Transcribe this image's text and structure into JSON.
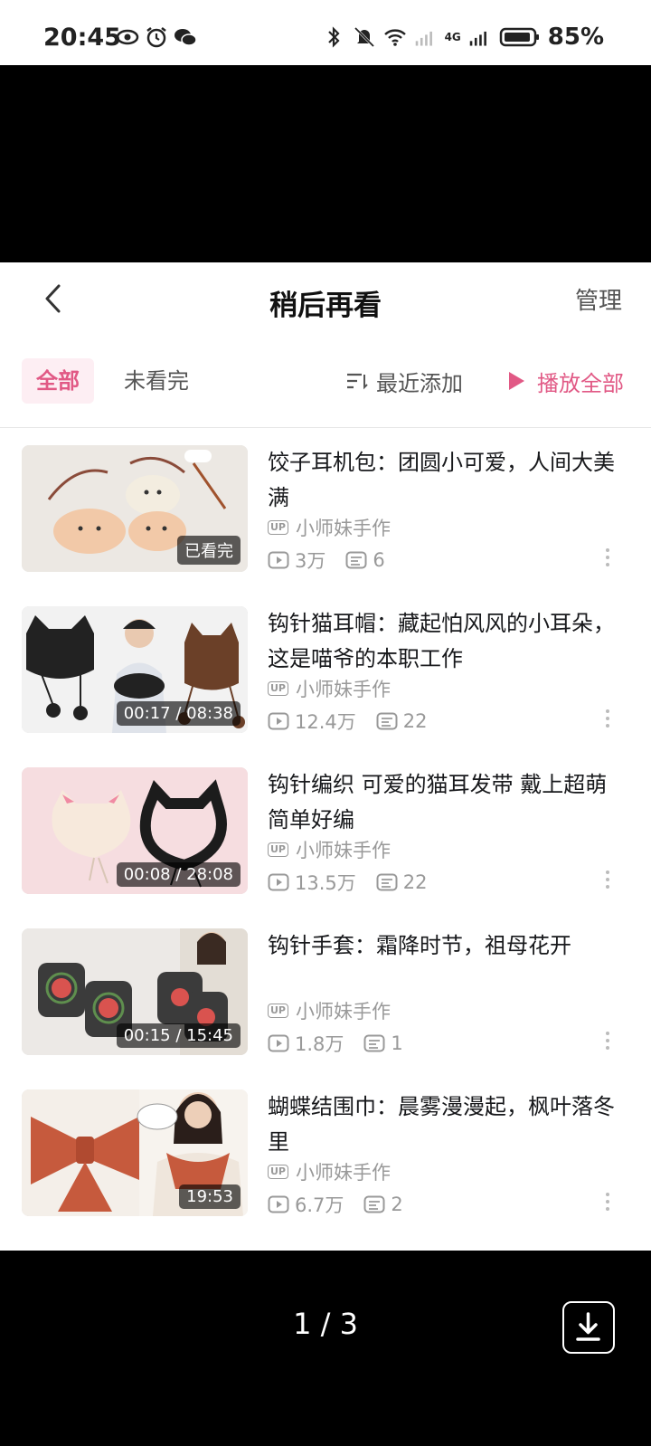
{
  "status_bar": {
    "time": "20:45",
    "battery": "85%",
    "network": "4G",
    "icons_left": [
      "eye-icon",
      "alarm-icon",
      "wechat-icon"
    ],
    "icons_right": [
      "bluetooth-icon",
      "mute-icon",
      "wifi-icon",
      "signal-icon",
      "battery-icon"
    ]
  },
  "header": {
    "title": "稍后再看",
    "manage": "管理"
  },
  "filters": {
    "all": "全部",
    "unfinished": "未看完",
    "sort": "最近添加",
    "play_all": "播放全部",
    "accent": "#e15985"
  },
  "videos": [
    {
      "title": "饺子耳机包：团圆小可爱，人间大美满",
      "uploader": "小师妹手作",
      "up_tag": "UP",
      "views": "3万",
      "danmaku": "6",
      "badge": "已看完"
    },
    {
      "title": "钩针猫耳帽：藏起怕风风的小耳朵，这是喵爷的本职工作",
      "uploader": "小师妹手作",
      "up_tag": "UP",
      "views": "12.4万",
      "danmaku": "22",
      "badge": "00:17 / 08:38"
    },
    {
      "title": "钩针编织 可爱的猫耳发带 戴上超萌简单好编",
      "uploader": "小师妹手作",
      "up_tag": "UP",
      "views": "13.5万",
      "danmaku": "22",
      "badge": "00:08 / 28:08"
    },
    {
      "title": "钩针手套：霜降时节，祖母花开",
      "uploader": "小师妹手作",
      "up_tag": "UP",
      "views": "1.8万",
      "danmaku": "1",
      "badge": "00:15 / 15:45"
    },
    {
      "title": "蝴蝶结围巾：晨雾漫漫起，枫叶落冬里",
      "uploader": "小师妹手作",
      "up_tag": "UP",
      "views": "6.7万",
      "danmaku": "2",
      "badge": "19:53"
    }
  ],
  "viewer": {
    "page": "1 / 3"
  }
}
